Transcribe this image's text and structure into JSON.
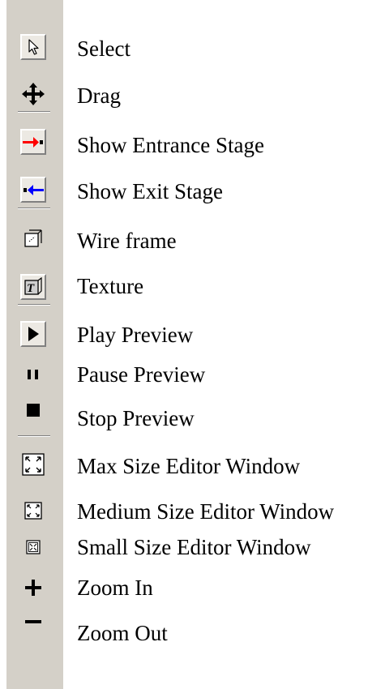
{
  "toolbar": {
    "items": [
      {
        "label": "Select",
        "icon": "select-arrow-icon"
      },
      {
        "label": "Drag",
        "icon": "move-arrows-icon"
      },
      {
        "label": "Show Entrance Stage",
        "icon": "entrance-arrow-icon"
      },
      {
        "label": "Show Exit Stage",
        "icon": "exit-arrow-icon"
      },
      {
        "label": "Wire frame",
        "icon": "wireframe-icon"
      },
      {
        "label": "Texture",
        "icon": "texture-icon"
      },
      {
        "label": "Play Preview",
        "icon": "play-icon"
      },
      {
        "label": "Pause Preview",
        "icon": "pause-icon"
      },
      {
        "label": "Stop Preview",
        "icon": "stop-icon"
      },
      {
        "label": "Max Size Editor Window",
        "icon": "max-size-icon"
      },
      {
        "label": "Medium Size Editor Window",
        "icon": "medium-size-icon"
      },
      {
        "label": "Small Size Editor Window",
        "icon": "small-size-icon"
      },
      {
        "label": "Zoom In",
        "icon": "zoom-in-icon"
      },
      {
        "label": "Zoom Out",
        "icon": "zoom-out-icon"
      }
    ]
  },
  "colors": {
    "toolbar_bg": "#d4d0c8",
    "entrance_arrow": "#ff0000",
    "exit_arrow": "#0000ff"
  }
}
